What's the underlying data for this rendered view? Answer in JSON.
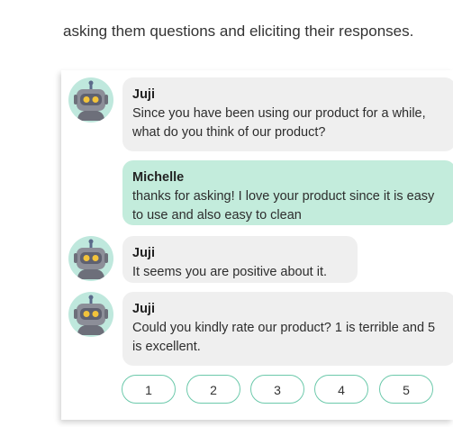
{
  "intro_text": "asking them questions and eliciting their responses.",
  "chat": {
    "messages": [
      {
        "sender": "Juji",
        "role": "bot",
        "text": "Since you have been using our product for a while, what do you think of our product?"
      },
      {
        "sender": "Michelle",
        "role": "user",
        "text": "thanks for asking! I love your product since it is easy to use and also easy to clean"
      },
      {
        "sender": "Juji",
        "role": "bot",
        "text": "It seems you are positive about it."
      },
      {
        "sender": "Juji",
        "role": "bot",
        "text": "Could you kindly rate our product? 1 is terrible and 5 is excellent."
      }
    ],
    "rating_options": [
      "1",
      "2",
      "3",
      "4",
      "5"
    ],
    "avatar_icon": "robot-icon"
  },
  "colors": {
    "bot_bubble": "#efefef",
    "user_bubble": "#c3ecdc",
    "avatar_bg": "#bfe8dd",
    "rating_border": "#6cc9ab",
    "robot_eye": "#f2c33b"
  }
}
